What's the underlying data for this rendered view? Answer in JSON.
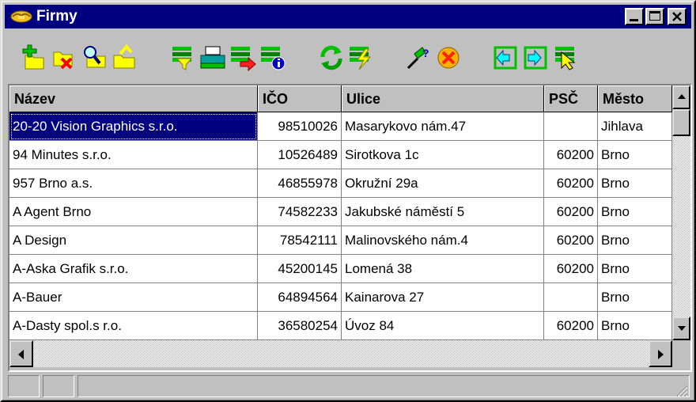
{
  "window": {
    "title": "Firmy",
    "title_icon": "handshake-icon",
    "controls": [
      "minimize-icon",
      "maximize-icon",
      "close-icon"
    ]
  },
  "toolbar": {
    "buttons": [
      {
        "name": "add-record-button",
        "icon": "folder-add-icon"
      },
      {
        "name": "delete-record-button",
        "icon": "folder-delete-icon"
      },
      {
        "name": "find-record-button",
        "icon": "folder-search-icon"
      },
      {
        "name": "open-record-button",
        "icon": "folder-open-icon"
      },
      {
        "name": "filter-button",
        "icon": "filter-icon"
      },
      {
        "name": "print-button",
        "icon": "printer-icon"
      },
      {
        "name": "export-button",
        "icon": "export-icon"
      },
      {
        "name": "info-button",
        "icon": "info-icon"
      },
      {
        "name": "refresh-button",
        "icon": "refresh-icon"
      },
      {
        "name": "run-button",
        "icon": "lightning-icon"
      },
      {
        "name": "help-button",
        "icon": "help-pointer-icon"
      },
      {
        "name": "cancel-button",
        "icon": "cancel-icon"
      },
      {
        "name": "first-record-button",
        "icon": "enter-left-icon"
      },
      {
        "name": "last-record-button",
        "icon": "enter-right-icon"
      },
      {
        "name": "select-button",
        "icon": "select-pointer-icon"
      }
    ]
  },
  "table": {
    "columns": [
      "Název",
      "IČO",
      "Ulice",
      "PSČ",
      "Město"
    ],
    "rows": [
      [
        "20-20 Vision Graphics s.r.o.",
        "98510026",
        "Masarykovo nám.47",
        "",
        "Jihlava"
      ],
      [
        "94 Minutes s.r.o.",
        "10526489",
        "Sirotkova 1c",
        "60200",
        "Brno"
      ],
      [
        "957 Brno a.s.",
        "46855978",
        "Okružní 29a",
        "60200",
        "Brno"
      ],
      [
        "A Agent Brno",
        "74582233",
        "Jakubské náměstí 5",
        "60200",
        "Brno"
      ],
      [
        "A Design",
        "78542111",
        "Malinovského nám.4",
        "60200",
        "Brno"
      ],
      [
        "A-Aska Grafik s.r.o.",
        "45200145",
        "Lomená 38",
        "60200",
        "Brno"
      ],
      [
        "A-Bauer",
        "64894564",
        "Kainarova 27",
        "",
        "Brno"
      ],
      [
        "A-Dasty spol.s r.o.",
        "36580254",
        "Úvoz 84",
        "60200",
        "Brno"
      ]
    ],
    "selected_row": 0
  },
  "colors": {
    "titlebar": "#000080",
    "selection": "#000080",
    "face": "#c0c0c0"
  }
}
